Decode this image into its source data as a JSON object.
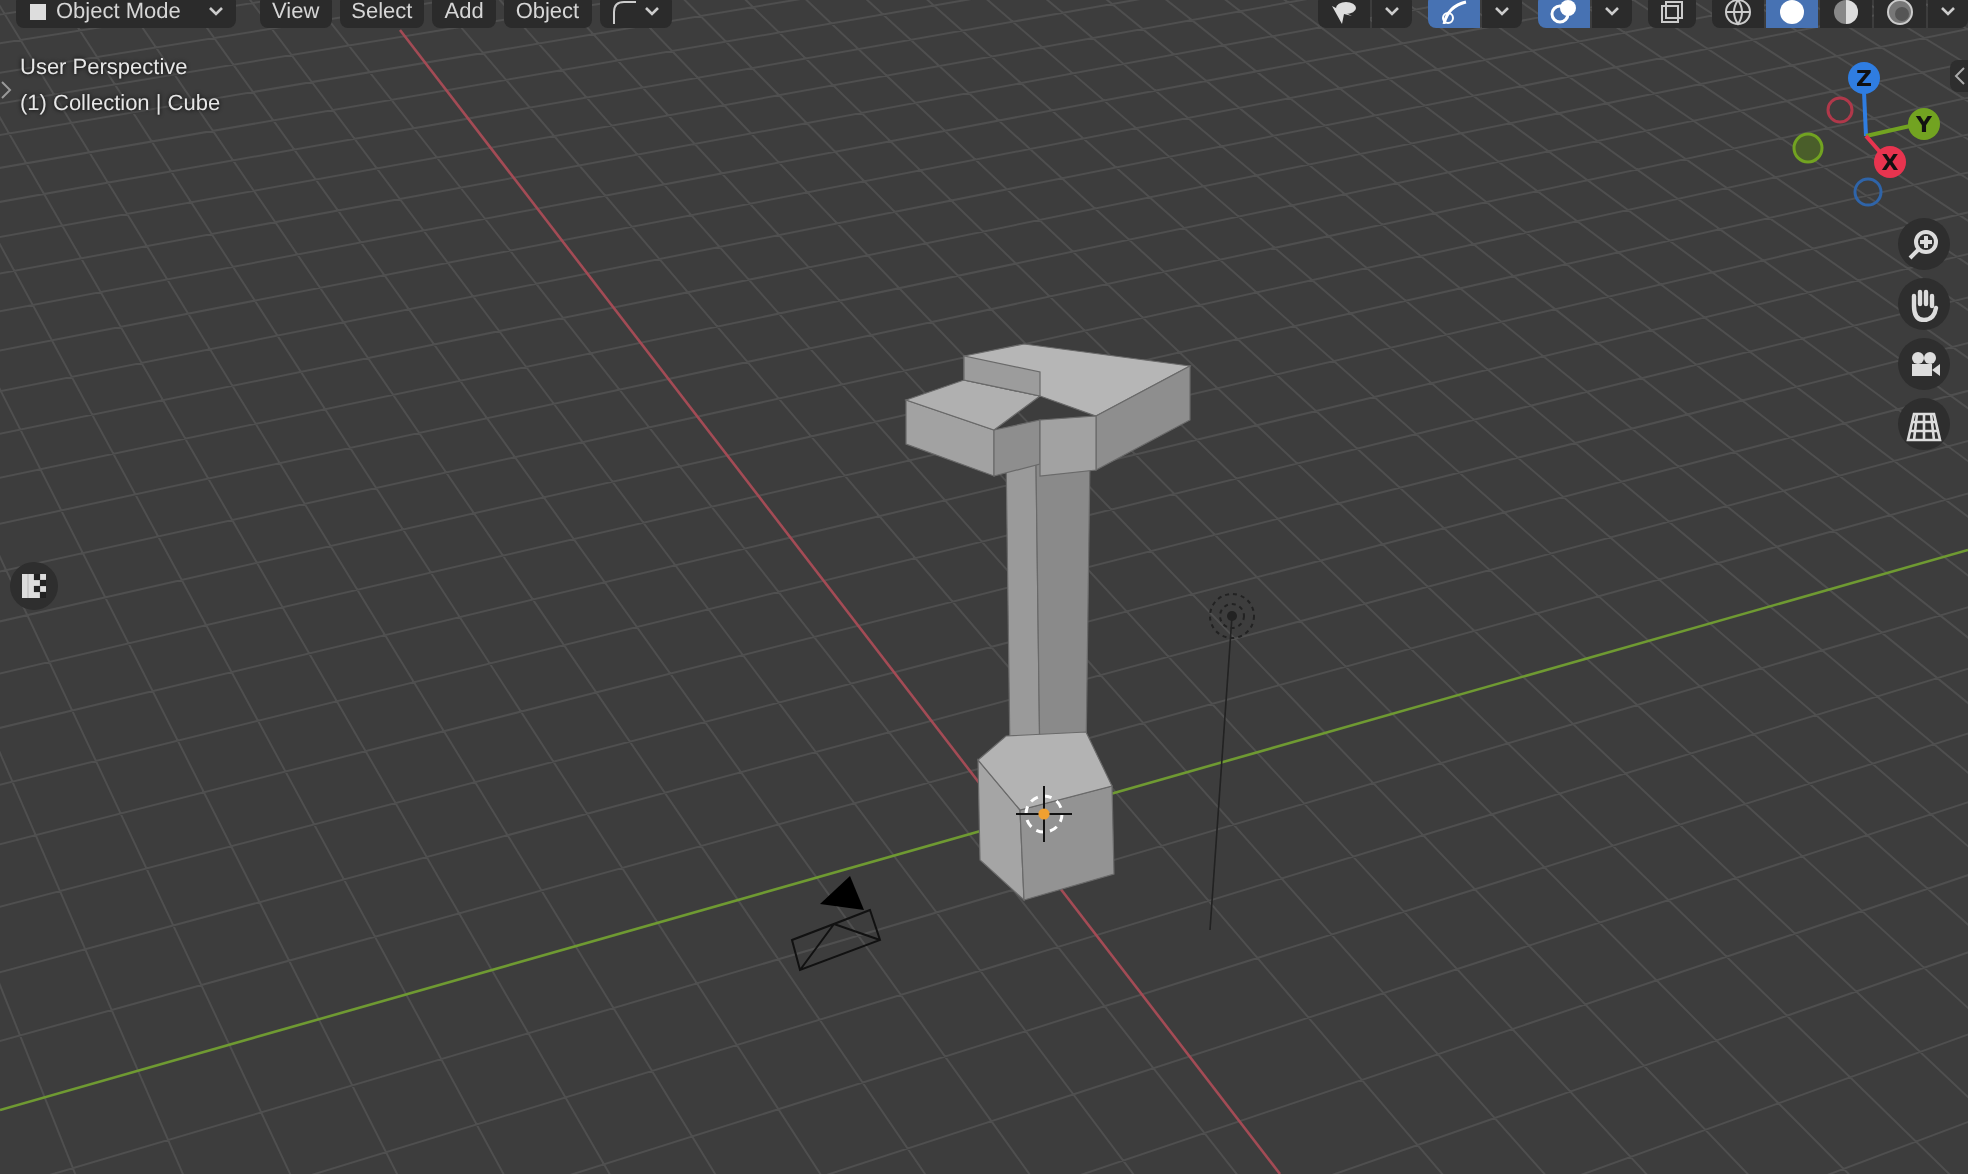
{
  "header": {
    "mode_menu": {
      "label": "Object Mode"
    },
    "menus": [
      {
        "label": "View"
      },
      {
        "label": "Select"
      },
      {
        "label": "Add"
      },
      {
        "label": "Object"
      }
    ],
    "toggles": [
      {
        "kind": "visibility",
        "selected": false
      },
      {
        "kind": "gizmo",
        "selected": true
      },
      {
        "kind": "overlay",
        "selected": true
      },
      {
        "kind": "xray",
        "selected": false
      }
    ],
    "shading": [
      {
        "kind": "wireframe",
        "selected": false
      },
      {
        "kind": "solid",
        "selected": true
      },
      {
        "kind": "material",
        "selected": false
      },
      {
        "kind": "rendered",
        "selected": false
      }
    ]
  },
  "viewport": {
    "view_name": "User Perspective",
    "object_info": "(1) Collection | Cube"
  },
  "gizmo": {
    "axes": [
      {
        "label": "Z"
      },
      {
        "label": "Y"
      },
      {
        "label": "X"
      }
    ]
  }
}
